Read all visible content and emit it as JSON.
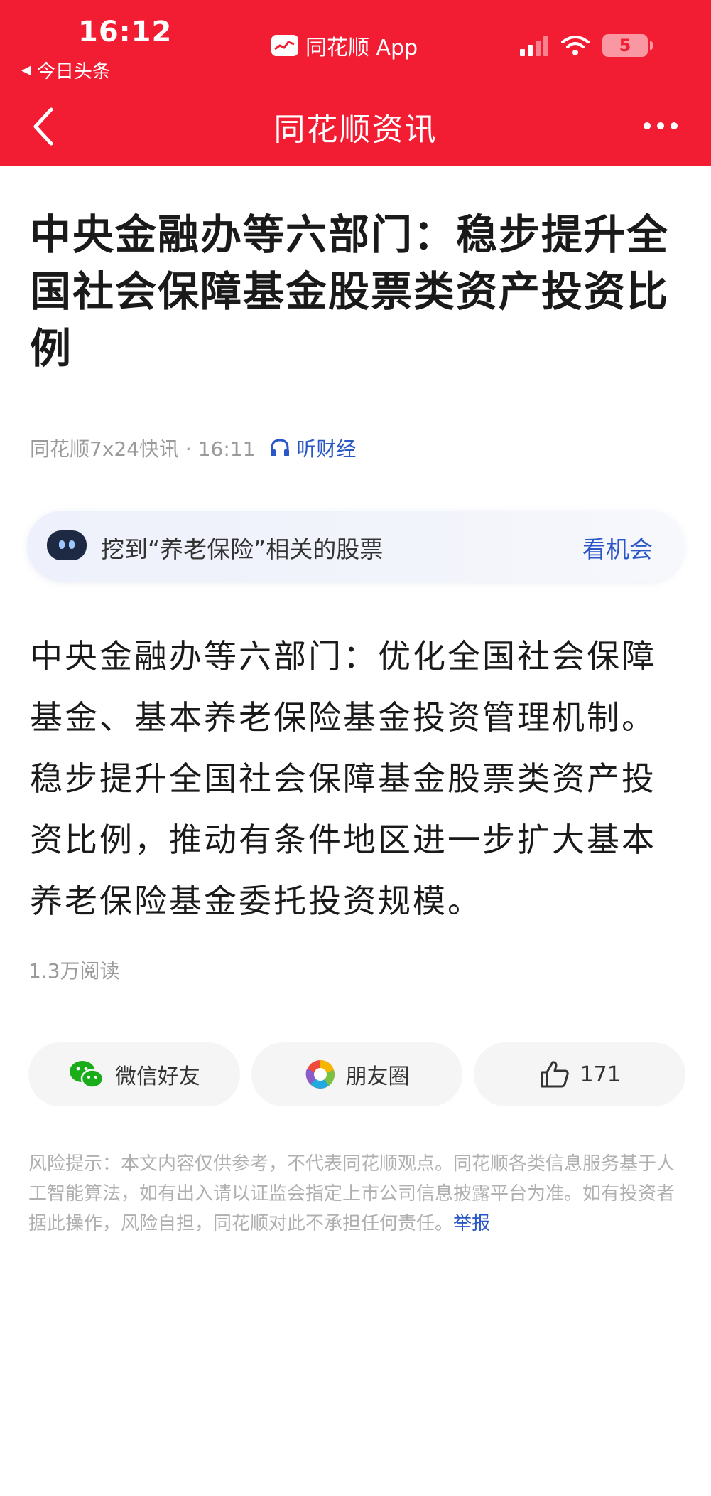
{
  "status_bar": {
    "time": "16:12",
    "back_app": "今日头条",
    "app_name": "同花顺 App",
    "battery": "5"
  },
  "nav": {
    "title": "同花顺资讯"
  },
  "article": {
    "title": "中央金融办等六部门：稳步提升全国社会保障基金股票类资产投资比例",
    "source": "同花顺7x24快讯 · 16:11",
    "listen_label": "听财经",
    "banner": {
      "text": "挖到“养老保险”相关的股票",
      "action": "看机会"
    },
    "body": "中央金融办等六部门：优化全国社会保障基金、基本养老保险基金投资管理机制。稳步提升全国社会保障基金股票类资产投资比例，推动有条件地区进一步扩大基本养老保险基金委托投资规模。",
    "read_count": "1.3万阅读"
  },
  "share": {
    "wechat": "微信好友",
    "moments": "朋友圈",
    "likes": "171"
  },
  "disclaimer": {
    "text": "风险提示：本文内容仅供参考，不代表同花顺观点。同花顺各类信息服务基于人工智能算法，如有出入请以证监会指定上市公司信息披露平台为准。如有投资者据此操作，风险自担，同花顺对此不承担任何责任。",
    "report": "举报"
  },
  "colors": {
    "brand_red": "#f21c33",
    "link_blue": "#2a56c6"
  }
}
